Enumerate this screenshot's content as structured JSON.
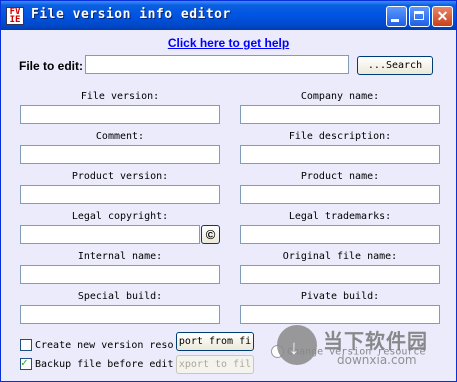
{
  "window": {
    "title": "File version info editor",
    "app_icon_text": "FV IE"
  },
  "help_link": "Click here to get help",
  "file_to_edit": {
    "label": "File to edit:",
    "value": "",
    "search_label": "...Search"
  },
  "fields": {
    "file_version": {
      "label": "File version:",
      "value": ""
    },
    "company_name": {
      "label": "Company name:",
      "value": ""
    },
    "comment": {
      "label": "Comment:",
      "value": ""
    },
    "file_description": {
      "label": "File description:",
      "value": ""
    },
    "product_version": {
      "label": "Product version:",
      "value": ""
    },
    "product_name": {
      "label": "Product name:",
      "value": ""
    },
    "legal_copyright": {
      "label": "Legal copyright:",
      "value": ""
    },
    "legal_trademarks": {
      "label": "Legal trademarks:",
      "value": ""
    },
    "internal_name": {
      "label": "Internal name:",
      "value": ""
    },
    "original_file_name": {
      "label": "Original file name:",
      "value": ""
    },
    "special_build": {
      "label": "Special build:",
      "value": ""
    },
    "private_build": {
      "label": "Pivate build:",
      "value": ""
    }
  },
  "copyright_button": "©",
  "options": {
    "create_new_version": {
      "label": "Create new version reso",
      "checked": false
    },
    "backup_file": {
      "label": "Backup file before edit",
      "checked": true
    }
  },
  "buttons": {
    "import_from_file": "port from fi",
    "export_to_file": "xport to fil"
  },
  "change_version_resource": {
    "label": "Change version resource",
    "selected": false
  },
  "watermark": {
    "text_cn": "当下软件园",
    "url": "downxia.com"
  }
}
